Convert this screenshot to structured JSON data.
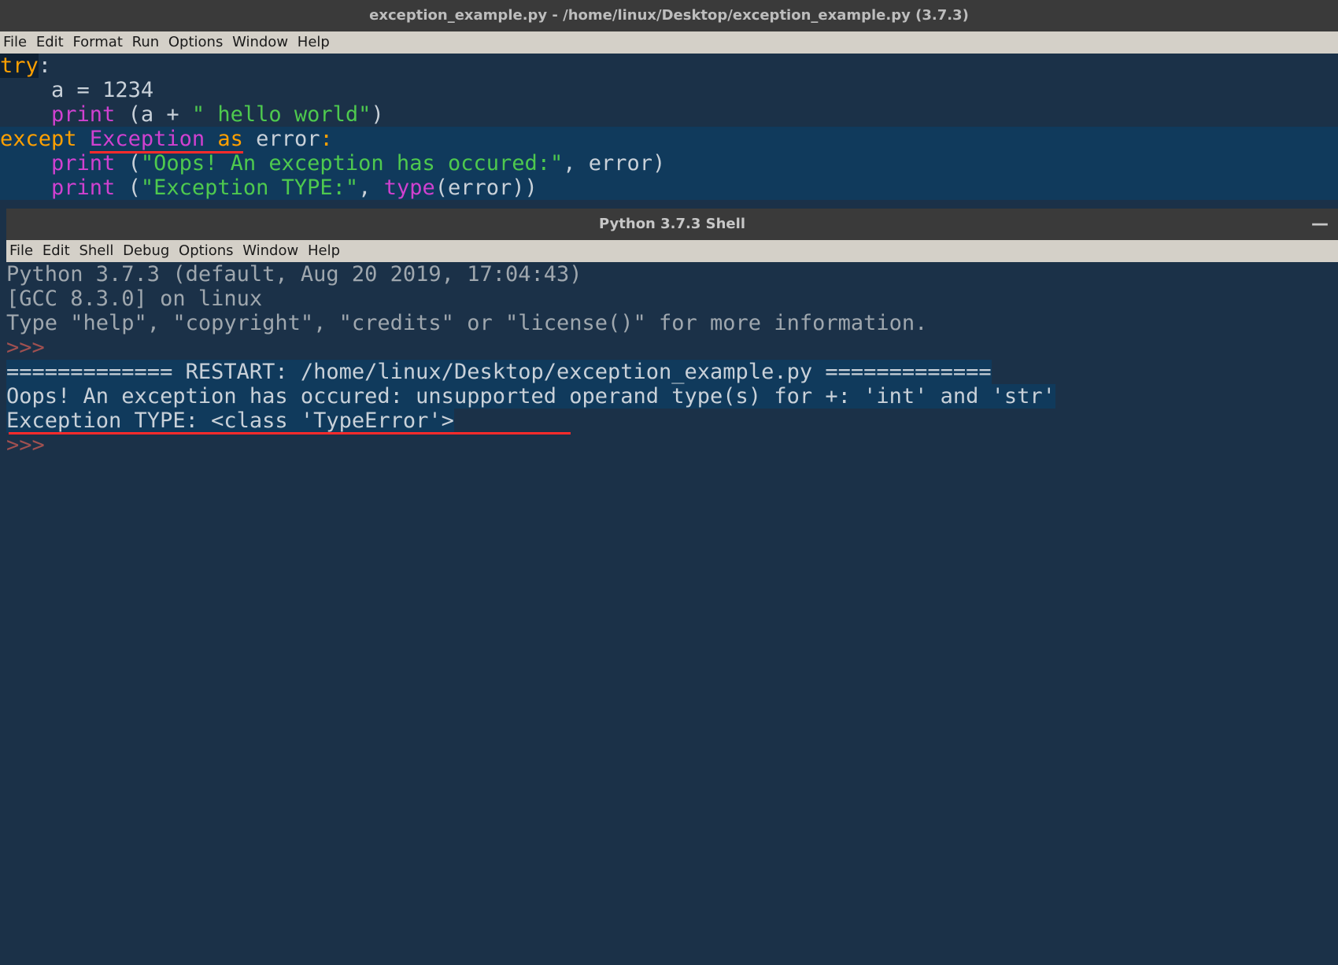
{
  "editor": {
    "title": "exception_example.py - /home/linux/Desktop/exception_example.py (3.7.3)",
    "menu": [
      "File",
      "Edit",
      "Format",
      "Run",
      "Options",
      "Window",
      "Help"
    ],
    "code": {
      "l1_try": "try",
      "l1_colon": ":",
      "l2_indent": "    ",
      "l2_a": "a ",
      "l2_eq": "= ",
      "l2_num": "1234",
      "l3_indent": "    ",
      "l3_print": "print",
      "l3_open": " (a ",
      "l3_plus": "+ ",
      "l3_str": "\" hello world\"",
      "l3_close": ")",
      "l4_except": "except",
      "l4_sp1": " ",
      "l4_exception": "Exception",
      "l4_sp2": " ",
      "l4_as": "as",
      "l4_sp3": " ",
      "l4_error": "error",
      "l4_colon": ":",
      "l5_indent": "    ",
      "l5_print": "print",
      "l5_open": " (",
      "l5_str": "\"Oops! An exception has occured:\"",
      "l5_rest": ", error)",
      "l6_indent": "    ",
      "l6_print": "print",
      "l6_open": " (",
      "l6_str": "\"Exception TYPE:\"",
      "l6_comma": ", ",
      "l6_type": "type",
      "l6_close": "(error))"
    }
  },
  "shell": {
    "title": "Python 3.7.3 Shell",
    "menu": [
      "File",
      "Edit",
      "Shell",
      "Debug",
      "Options",
      "Window",
      "Help"
    ],
    "banner1": "Python 3.7.3 (default, Aug 20 2019, 17:04:43) ",
    "banner2": "[GCC 8.3.0] on linux",
    "banner3": "Type \"help\", \"copyright\", \"credits\" or \"license()\" for more information.",
    "prompt": ">>>",
    "restart": "============= RESTART: /home/linux/Desktop/exception_example.py =============",
    "out1": "Oops! An exception has occured: unsupported operand type(s) for +: 'int' and 'str'",
    "out2": "Exception TYPE: <class 'TypeError'>",
    "min": "—"
  }
}
